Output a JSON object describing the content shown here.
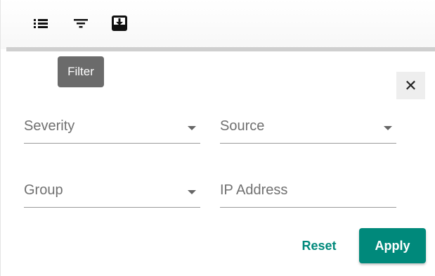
{
  "toolbar": {
    "buttons": [
      {
        "icon": "list-icon"
      },
      {
        "icon": "filter-icon"
      },
      {
        "icon": "download-icon"
      }
    ]
  },
  "tooltip": {
    "text": "Filter"
  },
  "close": {
    "icon": "close-icon",
    "glyph": "✕"
  },
  "fields": {
    "severity": {
      "label": "Severity",
      "has_dropdown": true
    },
    "source": {
      "label": "Source",
      "has_dropdown": true
    },
    "group": {
      "label": "Group",
      "has_dropdown": true
    },
    "ip_address": {
      "label": "IP Address",
      "has_dropdown": false
    }
  },
  "actions": {
    "reset_label": "Reset",
    "apply_label": "Apply"
  },
  "colors": {
    "accent": "#00897b",
    "tooltip_bg": "#6b6b6b",
    "divider": "#cfcfcf"
  }
}
